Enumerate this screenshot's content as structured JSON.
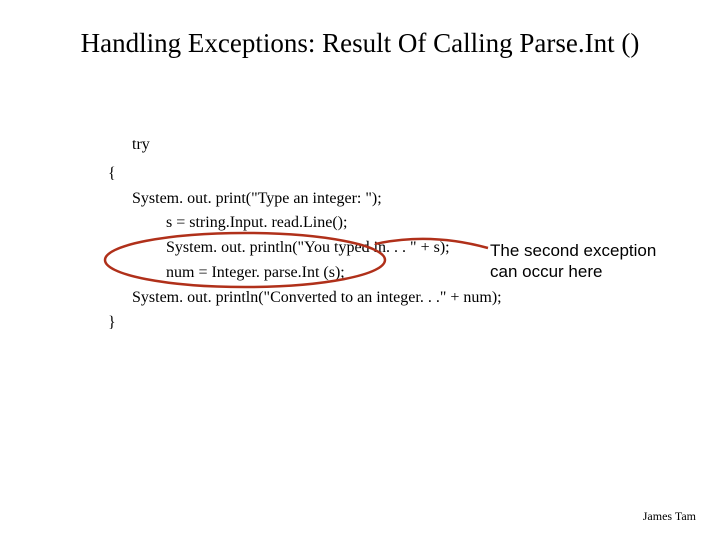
{
  "title": "Handling Exceptions: Result Of Calling Parse.Int ()",
  "code": {
    "try": "try",
    "open": "{",
    "l1": "System. out. print(\"Type an integer: \");",
    "l2": "s = string.Input. read.Line();",
    "l3": "System. out. println(\"You typed in. . . \" + s);",
    "l4": "num = Integer. parse.Int (s);",
    "l5": "System. out. println(\"Converted to an integer. . .\" + num);",
    "close": "}"
  },
  "callout": {
    "line1": "The second exception",
    "line2": "can occur here"
  },
  "footer": "James Tam",
  "annotation": {
    "ellipse_stroke": "#b0301a",
    "line_stroke": "#b0301a"
  }
}
